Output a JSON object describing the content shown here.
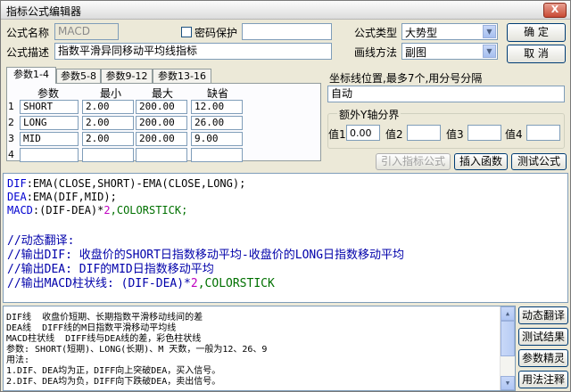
{
  "window": {
    "title": "指标公式编辑器",
    "close": "X"
  },
  "form": {
    "name_label": "公式名称",
    "name_value": "MACD",
    "password_label": "密码保护",
    "password_value": "",
    "desc_label": "公式描述",
    "desc_value": "指数平滑异同移动平均线指标",
    "type_label": "公式类型",
    "type_value": "大势型",
    "draw_label": "画线方法",
    "draw_value": "副图",
    "ok_label": "确  定",
    "cancel_label": "取  消"
  },
  "tabs": [
    "参数1-4",
    "参数5-8",
    "参数9-12",
    "参数13-16"
  ],
  "params": {
    "headers": [
      "参数",
      "最小",
      "最大",
      "缺省"
    ],
    "rows": [
      {
        "num": "1",
        "name": "SHORT",
        "min": "2.00",
        "max": "200.00",
        "default": "12.00"
      },
      {
        "num": "2",
        "name": "LONG",
        "min": "2.00",
        "max": "200.00",
        "default": "26.00"
      },
      {
        "num": "3",
        "name": "MID",
        "min": "2.00",
        "max": "200.00",
        "default": "9.00"
      },
      {
        "num": "4",
        "name": "",
        "min": "",
        "max": "",
        "default": ""
      }
    ]
  },
  "coord": {
    "label": "坐标线位置,最多7个,用分号分隔",
    "value": "自动",
    "group_title": "额外Y轴分界",
    "values": [
      {
        "label": "值1",
        "value": "0.00"
      },
      {
        "label": "值2",
        "value": ""
      },
      {
        "label": "值3",
        "value": ""
      },
      {
        "label": "值4",
        "value": ""
      }
    ]
  },
  "buttons": {
    "import": "引入指标公式",
    "insert_fn": "插入函数",
    "test": "测试公式",
    "dynamic_translate": "动态翻译",
    "test_result": "测试结果",
    "param_wizard": "参数精灵",
    "usage_note": "用法注释"
  },
  "code": {
    "line1": {
      "a": "DIF",
      "b": ":EMA(CLOSE,SHORT)-EMA(CLOSE,LONG);"
    },
    "line2": {
      "a": "DEA",
      "b": ":EMA(DIF,MID);"
    },
    "line3": {
      "a": "MACD",
      "b": ":(DIF-DEA)*",
      "c": "2",
      "d": ",COLORSTICK;"
    },
    "comment1": "//动态翻译:",
    "comment2": "//输出DIF: 收盘价的SHORT日指数移动平均-收盘价的LONG日指数移动平均",
    "comment3": "//输出DEA: DIF的MID日指数移动平均",
    "comment4a": "//输出MACD柱状线: (DIF-DEA)*",
    "comment4b": "2",
    "comment4c": ",COLORSTICK"
  },
  "help": [
    "DIF线  收盘价短期、长期指数平滑移动线间的差",
    "DEA线  DIFF线的M日指数平滑移动平均线",
    "MACD柱状线  DIFF线与DEA线的差，彩色柱状线",
    "参数: SHORT(短期)、LONG(长期)、M 天数，一般为12、26、9",
    "用法:",
    "1.DIF、DEA均为正，DIFF向上突破DEA，买入信号。",
    "2.DIF、DEA均为负，DIFF向下跌破DEA，卖出信号。"
  ]
}
